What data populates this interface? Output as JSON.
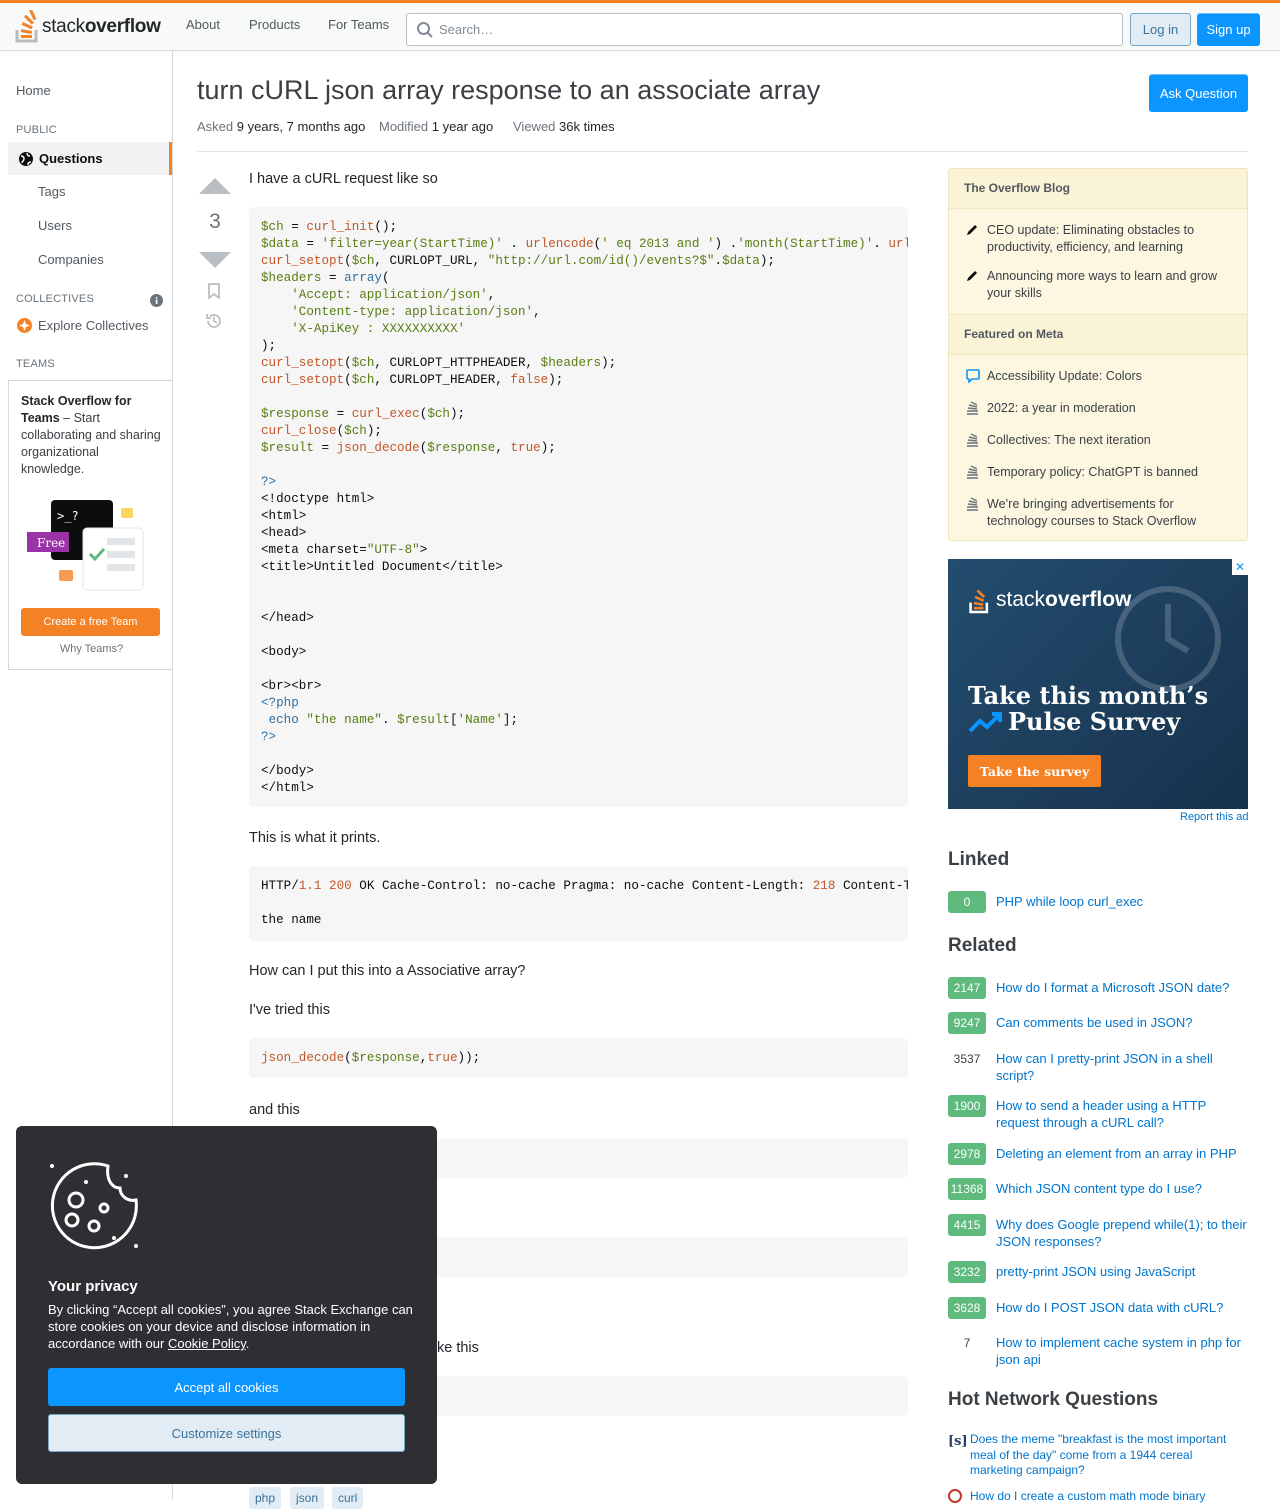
{
  "header": {
    "logo_text_light": "stack",
    "logo_text_bold": "overflow",
    "nav": [
      "About",
      "Products",
      "For Teams"
    ],
    "search_placeholder": "Search…",
    "login": "Log in",
    "signup": "Sign up",
    "accent": "#f48225"
  },
  "leftbar": {
    "home": "Home",
    "public": "PUBLIC",
    "questions": "Questions",
    "tags": "Tags",
    "users": "Users",
    "companies": "Companies",
    "collectives": "COLLECTIVES",
    "explore": "Explore Collectives",
    "teams": "TEAMS",
    "teams_bold": "Stack Overflow for Teams",
    "teams_text": " – Start collaborating and sharing organizational knowledge.",
    "free_badge": "Free",
    "create_team": "Create a free Team",
    "why_teams": "Why Teams?"
  },
  "question": {
    "title": "turn cURL json array response to an associate array",
    "asked_k": "Asked",
    "asked_v": "9 years, 7 months ago",
    "modified_k": "Modified",
    "modified_v": "1 year ago",
    "viewed_k": "Viewed",
    "viewed_v": "36k times",
    "ask_button": "Ask Question",
    "score": "3",
    "p1": "I have a cURL request like so",
    "p2": "This is what it prints.",
    "p3": "How can I put this into a Associative array?",
    "p4": "I've tried this",
    "p5": "and this",
    "p6": "ke this",
    "tags": [
      "php",
      "json",
      "curl"
    ]
  },
  "right": {
    "blog_head": "The Overflow Blog",
    "blog_items": [
      "CEO update: Eliminating obstacles to productivity, efficiency, and learning",
      "Announcing more ways to learn and grow your skills"
    ],
    "meta_head": "Featured on Meta",
    "meta_items": [
      "Accessibility Update: Colors",
      "2022: a year in moderation",
      "Collectives: The next iteration",
      "Temporary policy: ChatGPT is banned",
      "We’re bringing advertisements for technology courses to Stack Overflow"
    ],
    "ad_logo_light": "stack",
    "ad_logo_bold": "overflow",
    "ad_line1": "Take this month’s",
    "ad_line2": "Pulse Survey",
    "ad_button": "Take the survey",
    "ad_close": "✕",
    "report_ad": "Report this ad",
    "linked_head": "Linked",
    "linked": [
      {
        "score": "0",
        "title": "PHP while loop curl_exec"
      }
    ],
    "related_head": "Related",
    "related": [
      {
        "score": "2147",
        "title": "How do I format a Microsoft JSON date?",
        "accepted": true
      },
      {
        "score": "9247",
        "title": "Can comments be used in JSON?",
        "accepted": true
      },
      {
        "score": "3537",
        "title": "How can I pretty-print JSON in a shell script?",
        "accepted": false
      },
      {
        "score": "1900",
        "title": "How to send a header using a HTTP request through a cURL call?",
        "accepted": true
      },
      {
        "score": "2978",
        "title": "Deleting an element from an array in PHP",
        "accepted": true
      },
      {
        "score": "11368",
        "title": "Which JSON content type do I use?",
        "accepted": true
      },
      {
        "score": "4415",
        "title": "Why does Google prepend while(1); to their JSON responses?",
        "accepted": true
      },
      {
        "score": "3232",
        "title": "pretty-print JSON using JavaScript",
        "accepted": true
      },
      {
        "score": "3628",
        "title": "How do I POST JSON data with cURL?",
        "accepted": true
      },
      {
        "score": "7",
        "title": "How to implement cache system in php for json api",
        "accepted": false
      }
    ],
    "hot_head": "Hot Network Questions",
    "hot": [
      "Does the meme \"breakfast is the most important meal of the day\" come from a 1944 cereal marketing campaign?",
      "How do I create a custom math mode binary"
    ]
  },
  "cookie": {
    "title": "Your privacy",
    "body_pre": "By clicking “Accept all cookies”, you agree Stack Exchange can store cookies on your device and disclose information in accordance with our ",
    "policy": "Cookie Policy",
    "body_post": ".",
    "accept": "Accept all cookies",
    "customize": "Customize settings"
  }
}
